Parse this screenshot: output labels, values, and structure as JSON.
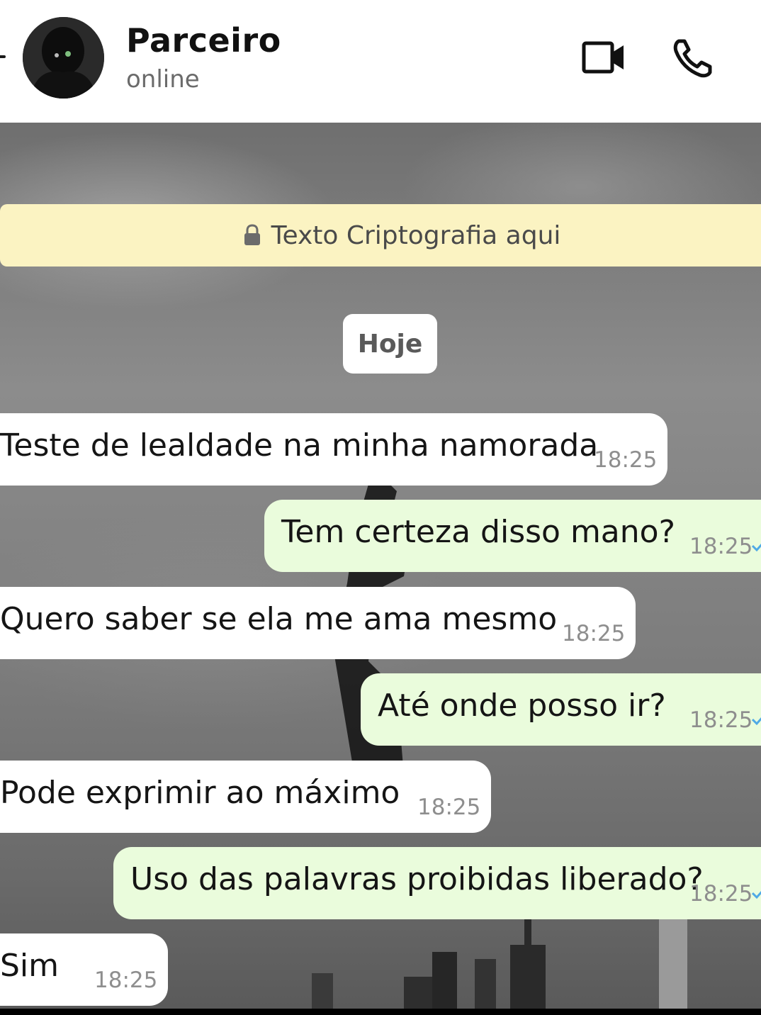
{
  "header": {
    "contact_name": "Parceiro",
    "status": "online",
    "avatar_icon": "avatar-silhouette",
    "video_icon": "video-camera-icon",
    "call_icon": "phone-icon"
  },
  "chat": {
    "encryption_banner": "Texto Criptografia aqui",
    "date_chip": "Hoje",
    "messages": [
      {
        "direction": "in",
        "text": "Teste de lealdade na minha namorada",
        "time": "18:25"
      },
      {
        "direction": "out",
        "text": "Tem certeza disso mano?",
        "time": "18:25"
      },
      {
        "direction": "in",
        "text": "Quero saber se ela me ama mesmo",
        "time": "18:25"
      },
      {
        "direction": "out",
        "text": "Até onde posso ir?",
        "time": "18:25"
      },
      {
        "direction": "in",
        "text": "Pode exprimir ao máximo",
        "time": "18:25"
      },
      {
        "direction": "out",
        "text": "Uso das palavras proibidas liberado?",
        "time": "18:25"
      },
      {
        "direction": "in",
        "text": "Sim",
        "time": "18:25"
      }
    ]
  },
  "colors": {
    "incoming_bubble": "#ffffff",
    "outgoing_bubble": "#eafcdc",
    "encryption_banner": "#fbf3c2",
    "tick": "#4fa9e6"
  }
}
